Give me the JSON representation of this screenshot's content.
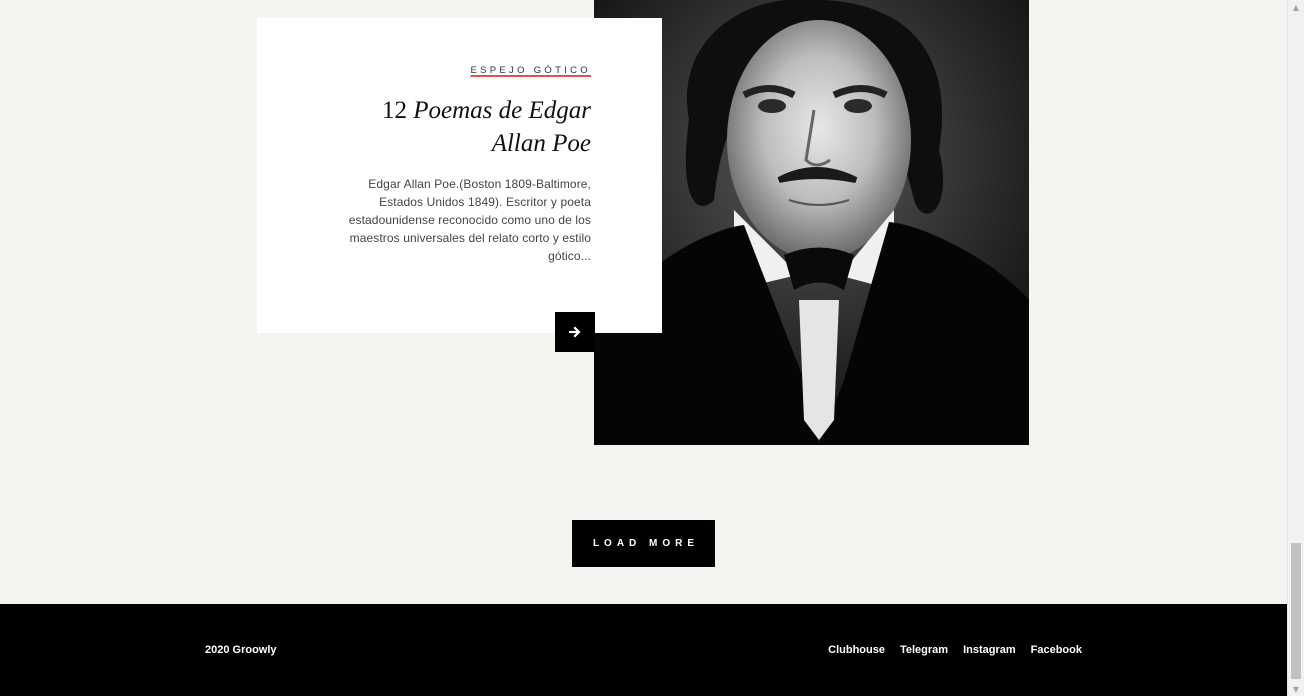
{
  "post": {
    "category": "Espejo Gótico",
    "title_number": "12",
    "title_italic": "Poemas de Edgar Allan Poe",
    "excerpt": "Edgar Allan Poe.(Boston 1809-Baltimore, Estados Unidos 1849). Escritor y poeta estadounidense reconocido como uno de los maestros universales del relato corto y estilo gótico...",
    "image_alt": "Edgar Allan Poe portrait",
    "read_more_icon": "arrow-right-icon"
  },
  "load_more": {
    "label": "LOAD MORE"
  },
  "footer": {
    "copyright": "2020 Groowly",
    "links": [
      "Clubhouse",
      "Telegram",
      "Instagram",
      "Facebook"
    ]
  },
  "colors": {
    "background": "#f4f4f0",
    "accent": "#e0524f",
    "footer": "#000000"
  },
  "scrollbar": {
    "up_icon": "▲",
    "down_icon": "▼"
  }
}
